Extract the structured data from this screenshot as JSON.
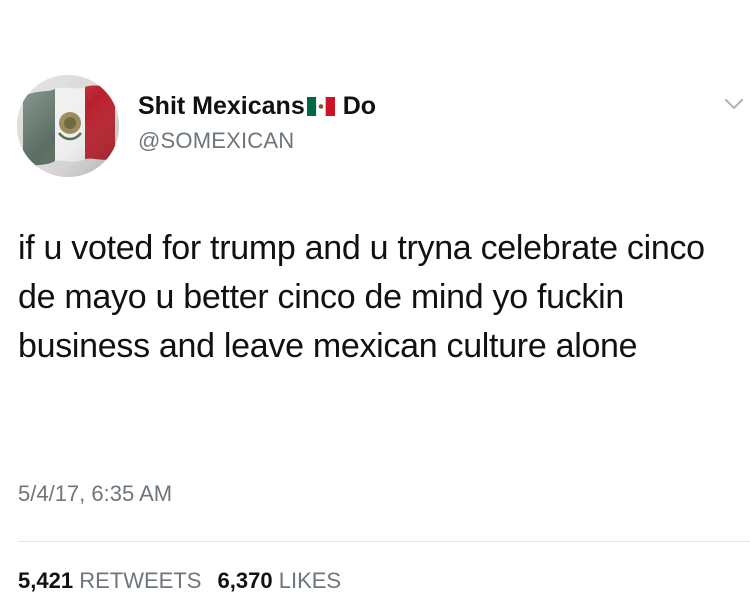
{
  "tweet": {
    "author": {
      "name_part1": "Shit Mexicans",
      "name_part2": "Do",
      "handle": "@SOMEXICAN",
      "name_emoji_icon": "mexico-flag-icon",
      "avatar_icon": "mexico-flag-avatar"
    },
    "menu_icon": "chevron-down-icon",
    "text": "if u voted for trump and u tryna celebrate cinco de mayo u better cinco de mind yo fuckin business and leave mexican culture alone",
    "timestamp": "5/4/17, 6:35 AM",
    "stats": {
      "retweets_count": "5,421",
      "retweets_label": "RETWEETS",
      "likes_count": "6,370",
      "likes_label": "LIKES"
    },
    "colors": {
      "text": "#111111",
      "secondary": "#6e767d",
      "flag_green": "#006847",
      "flag_red": "#ce1126"
    }
  }
}
